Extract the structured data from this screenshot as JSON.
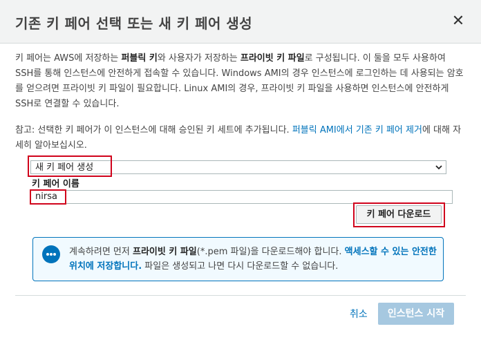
{
  "dialog": {
    "title": "기존 키 페어 선택 또는 새 키 페어 생성",
    "close_symbol": "✕"
  },
  "intro": {
    "t1": "키 페어는 AWS에 저장하는 ",
    "b1": "퍼블릭 키",
    "t2": "와 사용자가 저장하는 ",
    "b2": "프라이빗 키 파일",
    "t3": "로 구성됩니다. 이 둘을 모두 사용하여 SSH를 통해 인스턴스에 안전하게 접속할 수 있습니다. Windows AMI의 경우 인스턴스에 로그인하는 데 사용되는 암호를 얻으려면 프라이빗 키 파일이 필요합니다. Linux AMI의 경우, 프라이빗 키 파일을 사용하면 인스턴스에 안전하게 SSH로 연결할 수 있습니다."
  },
  "note": {
    "t1": "참고: 선택한 키 페어가 이 인스턴스에 대해 승인된 키 세트에 추가됩니다. ",
    "link": "퍼블릭 AMI에서 기존 키 페어 제거",
    "t2": "에 대해 자세히 알아보십시오."
  },
  "select": {
    "value": "새 키 페어 생성"
  },
  "keypair": {
    "label": "키 페어 이름",
    "value": "nirsa"
  },
  "download_button": "키 페어 다운로드",
  "info": {
    "t1": "계속하려면 먼저 ",
    "b1": "프라이빗 키 파일",
    "t2": "(*.pem 파일)을 다운로드해야 합니다. ",
    "b2": "액세스할 수 있는 안전한 위치에 저장합니다.",
    "t3": " 파일은 생성되고 나면 다시 다운로드할 수 없습니다."
  },
  "footer": {
    "cancel": "취소",
    "launch": "인스턴스 시작"
  },
  "colors": {
    "accent": "#0073bb",
    "highlight": "#d0021b",
    "disabled_button": "#a6c8e0"
  }
}
